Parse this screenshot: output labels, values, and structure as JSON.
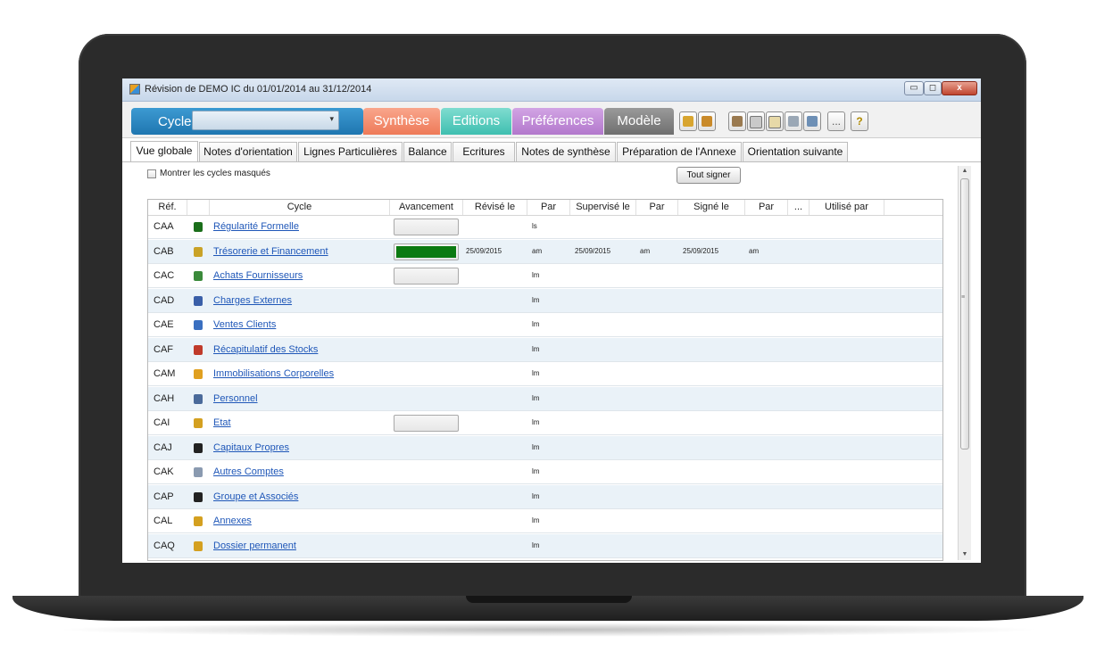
{
  "window": {
    "title": "Révision de DEMO IC du 01/01/2014 au 31/12/2014",
    "min_label": "▭",
    "max_label": "◻",
    "close_label": "x"
  },
  "toolbar": {
    "cycle_label": "Cycle",
    "cycle_value": "",
    "tabs": [
      "Synthèse",
      "Editions",
      "Préférences",
      "Modèle"
    ],
    "more_label": "...",
    "help_label": "?"
  },
  "view_tabs": [
    "Vue globale",
    "Notes d'orientation",
    "Lignes Particulières",
    "Balance",
    "Ecritures",
    "Notes de synthèse",
    "Préparation de l'Annexe",
    "Orientation suivante"
  ],
  "controls": {
    "show_hidden_label": "Montrer les cycles masqués",
    "sign_all_label": "Tout signer"
  },
  "table": {
    "headers": [
      "Réf.",
      "",
      "Cycle",
      "Avancement",
      "Révisé le",
      "Par",
      "Supervisé le",
      "Par",
      "Signé le",
      "Par",
      "...",
      "Utilisé par"
    ],
    "rows": [
      {
        "ref": "CAA",
        "icon": "check-icon",
        "icon_color": "#1a6e1a",
        "cycle": "Régularité Formelle",
        "progress": 0,
        "show_progress": true,
        "revised": "",
        "by": "ls",
        "supervised": "",
        "sup_by": "",
        "signed": "",
        "sig_by": ""
      },
      {
        "ref": "CAB",
        "icon": "bank-icon",
        "icon_color": "#c9a227",
        "cycle": "Trésorerie et Financement",
        "progress": 1.0,
        "show_progress": true,
        "revised": "25/09/2015",
        "by": "am",
        "supervised": "25/09/2015",
        "sup_by": "am",
        "signed": "25/09/2015",
        "sig_by": "am"
      },
      {
        "ref": "CAC",
        "icon": "supplier-icon",
        "icon_color": "#3b8a3b",
        "cycle": "Achats Fournisseurs",
        "progress": 0,
        "show_progress": true,
        "revised": "",
        "by": "lm",
        "supervised": "",
        "sup_by": "",
        "signed": "",
        "sig_by": ""
      },
      {
        "ref": "CAD",
        "icon": "building-icon",
        "icon_color": "#3a5fa8",
        "cycle": "Charges Externes",
        "progress": 0,
        "show_progress": false,
        "revised": "",
        "by": "lm",
        "supervised": "",
        "sup_by": "",
        "signed": "",
        "sig_by": ""
      },
      {
        "ref": "CAE",
        "icon": "client-icon",
        "icon_color": "#3a6fc0",
        "cycle": "Ventes Clients",
        "progress": 0,
        "show_progress": false,
        "revised": "",
        "by": "lm",
        "supervised": "",
        "sup_by": "",
        "signed": "",
        "sig_by": ""
      },
      {
        "ref": "CAF",
        "icon": "stock-icon",
        "icon_color": "#c03a2a",
        "cycle": "Récapitulatif des Stocks",
        "progress": 0,
        "show_progress": false,
        "revised": "",
        "by": "lm",
        "supervised": "",
        "sup_by": "",
        "signed": "",
        "sig_by": ""
      },
      {
        "ref": "CAM",
        "icon": "house-icon",
        "icon_color": "#e0a020",
        "cycle": "Immobilisations Corporelles",
        "progress": 0,
        "show_progress": false,
        "revised": "",
        "by": "lm",
        "supervised": "",
        "sup_by": "",
        "signed": "",
        "sig_by": ""
      },
      {
        "ref": "CAH",
        "icon": "person-icon",
        "icon_color": "#4a6a9a",
        "cycle": "Personnel",
        "progress": 0,
        "show_progress": false,
        "revised": "",
        "by": "lm",
        "supervised": "",
        "sup_by": "",
        "signed": "",
        "sig_by": ""
      },
      {
        "ref": "CAI",
        "icon": "state-icon",
        "icon_color": "#d4a020",
        "cycle": "Etat",
        "progress": 0,
        "show_progress": true,
        "revised": "",
        "by": "lm",
        "supervised": "",
        "sup_by": "",
        "signed": "",
        "sig_by": ""
      },
      {
        "ref": "CAJ",
        "icon": "equity-icon",
        "icon_color": "#222222",
        "cycle": "Capitaux Propres",
        "progress": 0,
        "show_progress": false,
        "revised": "",
        "by": "lm",
        "supervised": "",
        "sup_by": "",
        "signed": "",
        "sig_by": ""
      },
      {
        "ref": "CAK",
        "icon": "accounts-icon",
        "icon_color": "#8a9ab0",
        "cycle": "Autres Comptes",
        "progress": 0,
        "show_progress": false,
        "revised": "",
        "by": "lm",
        "supervised": "",
        "sup_by": "",
        "signed": "",
        "sig_by": ""
      },
      {
        "ref": "CAP",
        "icon": "group-icon",
        "icon_color": "#222222",
        "cycle": "Groupe et Associés",
        "progress": 0,
        "show_progress": false,
        "revised": "",
        "by": "lm",
        "supervised": "",
        "sup_by": "",
        "signed": "",
        "sig_by": ""
      },
      {
        "ref": "CAL",
        "icon": "pencil-icon",
        "icon_color": "#d4a020",
        "cycle": "Annexes",
        "progress": 0,
        "show_progress": false,
        "revised": "",
        "by": "lm",
        "supervised": "",
        "sup_by": "",
        "signed": "",
        "sig_by": ""
      },
      {
        "ref": "CAQ",
        "icon": "pencil-icon",
        "icon_color": "#d4a020",
        "cycle": "Dossier permanent",
        "progress": 0,
        "show_progress": false,
        "revised": "",
        "by": "lm",
        "supervised": "",
        "sup_by": "",
        "signed": "",
        "sig_by": ""
      }
    ]
  },
  "colors": {
    "progress_fill": "#0b7a12",
    "link": "#1f57b8"
  }
}
